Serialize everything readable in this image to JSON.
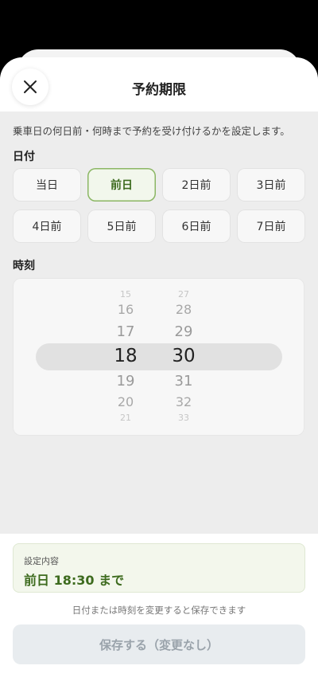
{
  "header": {
    "title": "予約期限"
  },
  "description": "乗車日の何日前・何時まで予約を受け付けるかを設定します。",
  "date_section": {
    "label": "日付",
    "options": [
      "当日",
      "前日",
      "2日前",
      "3日前",
      "4日前",
      "5日前",
      "6日前",
      "7日前"
    ],
    "selected": "前日"
  },
  "time_section": {
    "label": "時刻",
    "hour_wheel": [
      "15",
      "16",
      "17",
      "18",
      "19",
      "20",
      "21"
    ],
    "minute_wheel": [
      "27",
      "28",
      "29",
      "30",
      "31",
      "32",
      "33"
    ],
    "selected_hour": "18",
    "selected_minute": "30"
  },
  "summary": {
    "label": "設定内容",
    "value": "前日 18:30 まで"
  },
  "hint": "日付または時刻を変更すると保存できます",
  "save_button": {
    "label": "保存する（変更なし）",
    "enabled": false
  },
  "colors": {
    "accent": "#3d6b1e",
    "accent_border": "#8bb664",
    "summary_bg": "#f3f7ec"
  },
  "icons": {
    "close": "close-icon"
  }
}
